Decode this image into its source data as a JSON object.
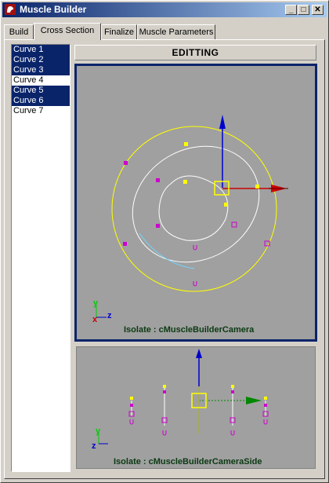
{
  "window": {
    "title": "Muscle Builder"
  },
  "tabs": [
    {
      "label": "Build"
    },
    {
      "label": "Cross Section"
    },
    {
      "label": "Finalize"
    },
    {
      "label": "Muscle Parameters"
    }
  ],
  "curves": [
    {
      "label": "Curve 1",
      "selected": true
    },
    {
      "label": "Curve 2",
      "selected": true
    },
    {
      "label": "Curve 3",
      "selected": true
    },
    {
      "label": "Curve 4",
      "selected": false
    },
    {
      "label": "Curve 5",
      "selected": true
    },
    {
      "label": "Curve 6",
      "selected": true
    },
    {
      "label": "Curve 7",
      "selected": false
    }
  ],
  "header": {
    "status": "EDITTING"
  },
  "viewports": {
    "main_label": "Isolate : cMuscleBuilderCamera",
    "side_label": "Isolate : cMuscleBuilderCameraSide",
    "axis_y": "y",
    "axis_z": "z"
  },
  "colors": {
    "selection": "#0a246a",
    "viewport_bg": "#a0a0a0",
    "label_green": "#0b3a12",
    "curve_yellow": "#ffff00",
    "handle_magenta": "#cc00cc"
  }
}
